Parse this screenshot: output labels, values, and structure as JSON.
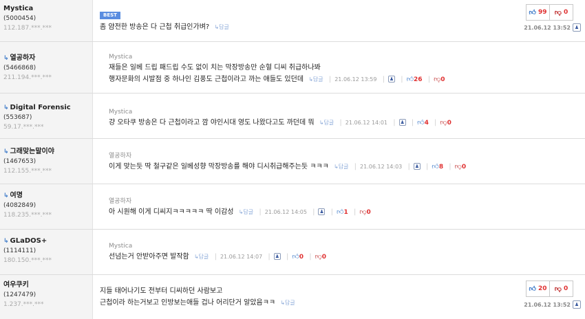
{
  "reply_label": "답글",
  "comments": [
    {
      "nick": "Mystica",
      "uid": "(5000454)",
      "ip": "112.187.***.***",
      "best": "BEST",
      "lines": [
        "좀 얌전한 방송은 다 근첩 취급인가벼?"
      ],
      "likes": "99",
      "dislikes": "0",
      "date": "21.06.12 13:52"
    },
    {
      "nick": "열공하자",
      "uid": "(5466868)",
      "ip": "211.194.***.***",
      "quoted": "Mystica",
      "lines": [
        "재들은 일베 드립 패드립 수도 없이 치는 막장방송만 순혈 디씨 취급하나봐",
        "행자문화의 시발점 중 하나인 김풍도 근첩이라고 까는 애들도 있던데"
      ],
      "likes": "26",
      "dislikes": "0",
      "date": "21.06.12 13:59"
    },
    {
      "nick": "Digital Forensic",
      "uid": "(553687)",
      "ip": "59.17.***.***",
      "quoted": "Mystica",
      "lines": [
        "걍 오타쿠 방송은 다 근첩이라고 깜 야인시대 영도 나왔다고도 까던데 뭐"
      ],
      "likes": "4",
      "dislikes": "0",
      "date": "21.06.12 14:01"
    },
    {
      "nick": "그래맞는말이야",
      "uid": "(1467653)",
      "ip": "112.155.***.***",
      "quoted": "열공하자",
      "lines": [
        "이게 맞는듯 딱 철구같은 일베성향 막장방송를 해야 디시취급해주는듯 ㅋㅋㅋ"
      ],
      "likes": "8",
      "dislikes": "0",
      "date": "21.06.12 14:03"
    },
    {
      "nick": "여명",
      "uid": "(4082849)",
      "ip": "118.235.***.***",
      "quoted": "열공하자",
      "lines": [
        "아 시원해 이게 디씨지ㅋㅋㅋㅋㅋ 딱 이감성"
      ],
      "likes": "1",
      "dislikes": "0",
      "date": "21.06.12 14:05"
    },
    {
      "nick": "GLaDOS+",
      "uid": "(1114111)",
      "ip": "180.150.***.***",
      "quoted": "Mystica",
      "lines": [
        "선넘는거 안받아주면 발작함"
      ],
      "likes": "0",
      "dislikes": "0",
      "date": "21.06.12 14:07"
    },
    {
      "nick": "여우쿠키",
      "uid": "(1247479)",
      "ip": "1.237.***.***",
      "lines": [
        "지들 태어나기도 전부터 디씨하던 사람보고",
        "근첩이라 하는거보고 인방보는애들 겁나 어리단거 알았음ㅋㅋ"
      ],
      "likes": "20",
      "dislikes": "0",
      "date": "21.06.12 13:52"
    }
  ]
}
